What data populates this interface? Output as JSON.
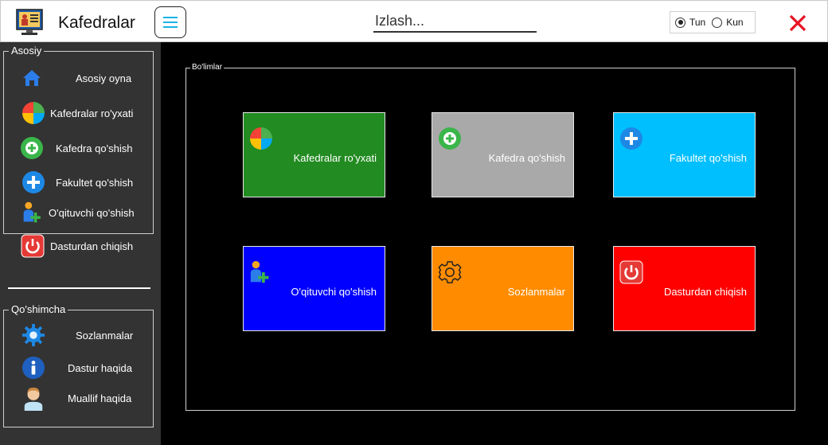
{
  "app": {
    "title": "Kafedralar",
    "search_placeholder": "Izlash...",
    "theme": {
      "options": [
        {
          "label": "Tun",
          "selected": true
        },
        {
          "label": "Kun",
          "selected": false
        }
      ]
    }
  },
  "colors": {
    "sidebar_bg": "#333333",
    "main_bg": "#000000",
    "close_red": "#e81123",
    "menu_icon": "#1ab3e6"
  },
  "sidebar": {
    "group1_title": "Asosiy",
    "group1_items": [
      {
        "label": "Asosiy oyna",
        "icon": "home-icon"
      },
      {
        "label": "Kafedralar ro'yxati",
        "icon": "pie-chart-icon"
      },
      {
        "label": "Kafedra qo'shish",
        "icon": "add-circle-green-icon"
      },
      {
        "label": "Fakultet qo'shish",
        "icon": "add-circle-blue-icon"
      },
      {
        "label": "O'qituvchi qo'shish",
        "icon": "add-user-icon"
      },
      {
        "label": "Dasturdan chiqish",
        "icon": "power-icon"
      }
    ],
    "group2_title": "Qo'shimcha",
    "group2_items": [
      {
        "label": "Sozlanmalar",
        "icon": "gear-icon"
      },
      {
        "label": "Dastur haqida",
        "icon": "info-icon"
      },
      {
        "label": "Muallif haqida",
        "icon": "author-icon"
      }
    ]
  },
  "main": {
    "sections_title": "Bo'limlar",
    "tiles": [
      {
        "label": "Kafedralar ro'yxati",
        "color": "#228b22",
        "icon": "pie-chart-icon"
      },
      {
        "label": "Kafedra qo'shish",
        "color": "#a9a9a9",
        "icon": "add-circle-green-icon"
      },
      {
        "label": "Fakultet qo'shish",
        "color": "#00bfff",
        "icon": "add-circle-blue-icon"
      },
      {
        "label": "O'qituvchi qo'shish",
        "color": "#0000ff",
        "icon": "add-user-icon"
      },
      {
        "label": "Sozlanmalar",
        "color": "#ff8c00",
        "icon": "gear-outline-icon"
      },
      {
        "label": "Dasturdan chiqish",
        "color": "#ff0000",
        "icon": "power-icon"
      }
    ]
  }
}
